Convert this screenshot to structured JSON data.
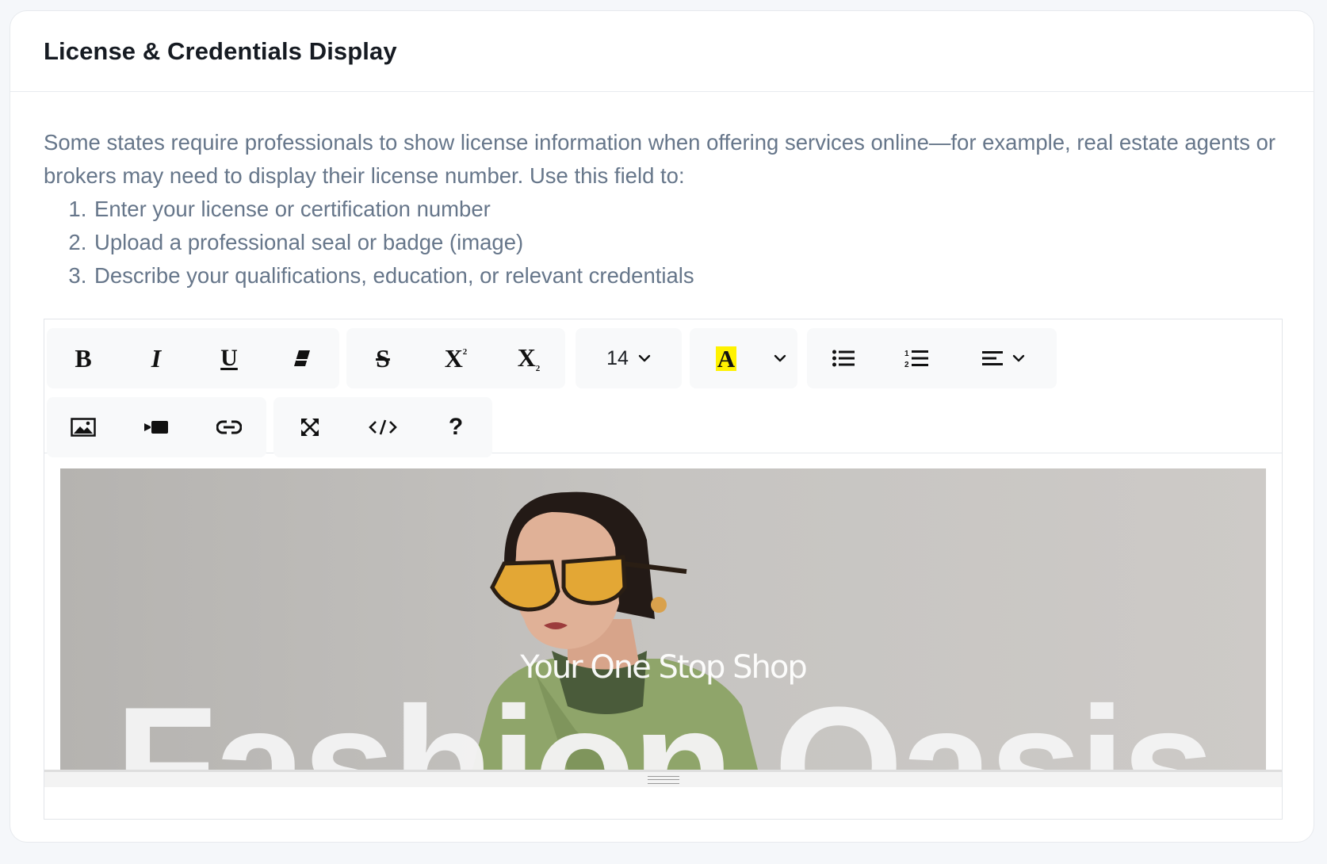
{
  "card": {
    "title": "License & Credentials Display",
    "description": {
      "intro": "Some states require professionals to show license information when offering services online—for example, real estate agents or brokers may need to display their license number. Use this field to:",
      "items": [
        "Enter your license or certification number",
        "Upload a professional seal or badge (image)",
        "Describe your qualifications, education, or relevant credentials"
      ]
    }
  },
  "editor": {
    "toolbar": {
      "row1": [
        "bold-icon",
        "italic-icon",
        "underline-icon",
        "eraser-icon",
        "strikethrough-icon",
        "superscript-icon",
        "subscript-icon",
        "font-size-select",
        "highlight-color-icon",
        "unordered-list-icon",
        "ordered-list-icon",
        "align-icon"
      ],
      "row2": [
        "image-icon",
        "video-icon",
        "link-icon",
        "fullscreen-icon",
        "code-view-icon",
        "help-icon"
      ],
      "font_size": "14",
      "highlight_color": "#fff200",
      "glyphs": {
        "bold": "B",
        "italic": "I",
        "underline": "U",
        "strike": "S",
        "superscript": "X",
        "subscript": "X",
        "highlight": "A",
        "help": "?"
      }
    },
    "content": {
      "image_tagline": "Your One Stop Shop",
      "image_brand": "Fashion Oasis"
    }
  }
}
